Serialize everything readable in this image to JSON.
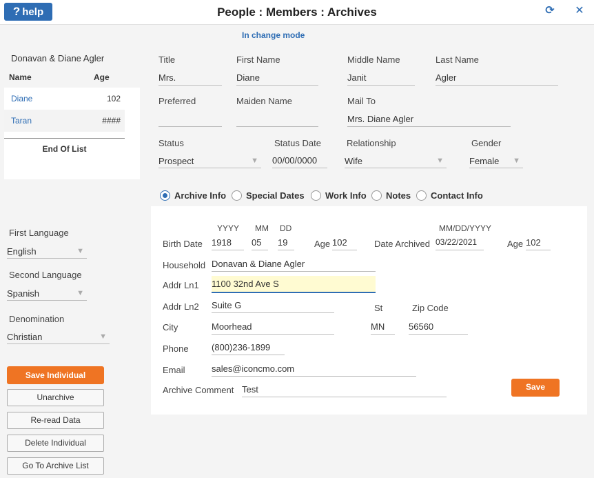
{
  "header": {
    "help_label": "help",
    "title": "People : Members : Archives",
    "refresh_icon": "refresh-icon",
    "close_icon": "close-icon"
  },
  "mode_text": "In change mode",
  "household": {
    "name": "Donavan & Diane Agler",
    "col_name": "Name",
    "col_age": "Age",
    "members": [
      {
        "name": "Diane",
        "age": "102"
      },
      {
        "name": "Taran",
        "age": "####"
      }
    ],
    "end_of_list": "End Of List"
  },
  "person": {
    "title_label": "Title",
    "title_value": "Mrs.",
    "first_label": "First Name",
    "first_value": "Diane",
    "middle_label": "Middle Name",
    "middle_value": "Janit",
    "last_label": "Last Name",
    "last_value": "Agler",
    "preferred_label": "Preferred",
    "preferred_value": "",
    "maiden_label": "Maiden Name",
    "maiden_value": "",
    "mailto_label": "Mail To",
    "mailto_value": "Mrs. Diane Agler",
    "status_label": "Status",
    "status_value": "Prospect",
    "status_date_label": "Status Date",
    "status_date_value": "00/00/0000",
    "relationship_label": "Relationship",
    "relationship_value": "Wife",
    "gender_label": "Gender",
    "gender_value": "Female"
  },
  "left_fields": {
    "first_language_label": "First Language",
    "first_language_value": "English",
    "second_language_label": "Second Language",
    "second_language_value": "Spanish",
    "denomination_label": "Denomination",
    "denomination_value": "Christian"
  },
  "tabs": [
    {
      "label": "Archive Info",
      "selected": true
    },
    {
      "label": "Special Dates",
      "selected": false
    },
    {
      "label": "Work Info",
      "selected": false
    },
    {
      "label": "Notes",
      "selected": false
    },
    {
      "label": "Contact Info",
      "selected": false
    }
  ],
  "archive": {
    "yyyy_label": "YYYY",
    "mm_label": "MM",
    "dd_label": "DD",
    "birth_date_label": "Birth Date",
    "birth_year": "1918",
    "birth_month": "05",
    "birth_day": "19",
    "age_label": "Age",
    "age_value": "102",
    "date_fmt_label": "MM/DD/YYYY",
    "date_archived_label": "Date Archived",
    "date_archived_value": "03/22/2021",
    "age2_label": "Age",
    "age2_value": "102",
    "household_label": "Household",
    "household_value": "Donavan & Diane Agler",
    "addr1_label": "Addr Ln1",
    "addr1_value": "1100 32nd Ave S",
    "addr2_label": "Addr Ln2",
    "addr2_value": "Suite G",
    "st_label": "St",
    "zip_label": "Zip Code",
    "city_label": "City",
    "city_value": "Moorhead",
    "st_value": "MN",
    "zip_value": "56560",
    "phone_label": "Phone",
    "phone_value": "(800)236-1899",
    "email_label": "Email",
    "email_value": "sales@iconcmo.com",
    "comment_label": "Archive Comment",
    "comment_value": "Test",
    "save_label": "Save"
  },
  "actions": {
    "save_individual": "Save Individual",
    "unarchive": "Unarchive",
    "reread": "Re-read Data",
    "delete": "Delete Individual",
    "goto_list": "Go To Archive List"
  },
  "colors": {
    "accent": "#2e6db4",
    "orange": "#ef7423",
    "highlight": "#fffbd2"
  }
}
